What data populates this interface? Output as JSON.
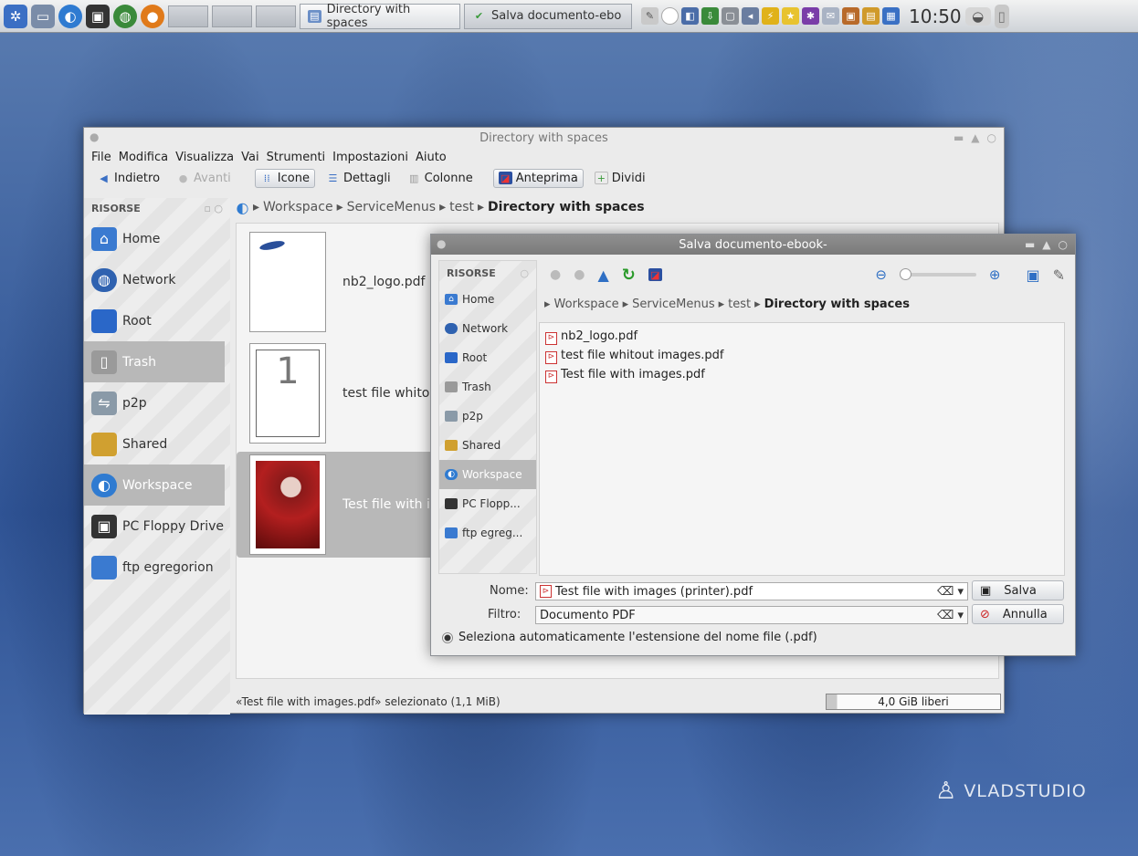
{
  "taskbar": {
    "tasks": [
      "Directory with spaces",
      "Salva documento-ebo"
    ],
    "clock": "10:50"
  },
  "dolphin": {
    "title": "Directory with spaces",
    "menu": [
      "File",
      "Modifica",
      "Visualizza",
      "Vai",
      "Strumenti",
      "Impostazioni",
      "Aiuto"
    ],
    "toolbar": {
      "back": "Indietro",
      "forward": "Avanti",
      "icons": "Icone",
      "details": "Dettagli",
      "columns": "Colonne",
      "preview": "Anteprima",
      "split": "Dividi"
    },
    "places_header": "RISORSE",
    "places": [
      "Home",
      "Network",
      "Root",
      "Trash",
      "p2p",
      "Shared",
      "Workspace",
      "PC Floppy Drive",
      "ftp egregorion"
    ],
    "breadcrumb": [
      "Workspace",
      "ServiceMenus",
      "test"
    ],
    "breadcrumb_current": "Directory with spaces",
    "files": [
      "nb2_logo.pdf",
      "test file whitout images.pdf",
      "Test file with images.pdf"
    ],
    "thumb_page_number": "1",
    "status": "«Test file with images.pdf» selezionato (1,1 MiB)",
    "free_space": "4,0 GiB liberi"
  },
  "dialog": {
    "title": "Salva documento-ebook-",
    "places_header": "RISORSE",
    "places": [
      "Home",
      "Network",
      "Root",
      "Trash",
      "p2p",
      "Shared",
      "Workspace",
      "PC Flopp...",
      "ftp egreg..."
    ],
    "breadcrumb": [
      "Workspace",
      "ServiceMenus",
      "test"
    ],
    "breadcrumb_current": "Directory with spaces",
    "files": [
      "nb2_logo.pdf",
      "test file whitout images.pdf",
      "Test file with images.pdf"
    ],
    "name_label": "Nome:",
    "name_value": "Test file with images (printer).pdf",
    "filter_label": "Filtro:",
    "filter_value": "Documento PDF",
    "save_button": "Salva",
    "cancel_button": "Annulla",
    "auto_extension": "Seleziona automaticamente l'estensione del nome file (.pdf)"
  },
  "watermark": "VLADSTUDIO"
}
